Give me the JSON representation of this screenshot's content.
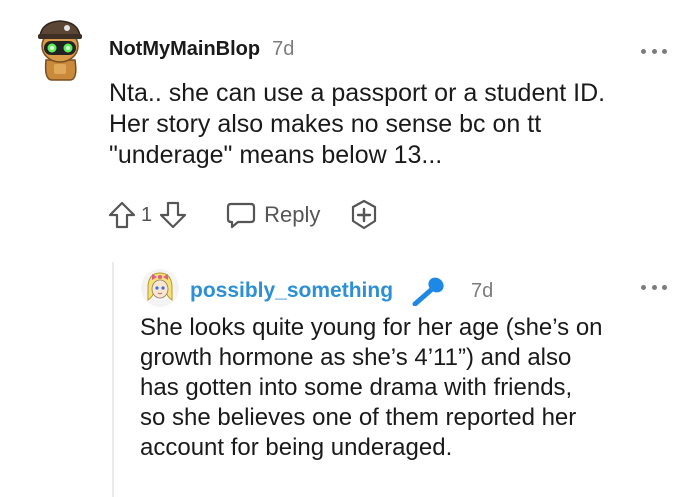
{
  "top_comment": {
    "username": "NotMyMainBlop",
    "time": "7d",
    "body_lines": [
      "Nta.. she can use a passport or a student ID.",
      "Her story also makes no sense bc on tt",
      "\"underage\" means below 13..."
    ],
    "vote_count": "1",
    "reply_label": "Reply"
  },
  "reply_comment": {
    "username": "possibly_something",
    "time": "7d",
    "body_lines": [
      "She looks quite young for her age (she’s on",
      "growth hormone as she’s 4’11”) and also",
      "has gotten into some drama with friends,",
      "so she believes one of them reported her",
      "account for being underaged."
    ]
  },
  "colors": {
    "username_reply": "#2d8fd5",
    "meta_gray": "#7c7c7c",
    "icon_gray": "#555555",
    "flair_blue": "#1e88e5"
  }
}
